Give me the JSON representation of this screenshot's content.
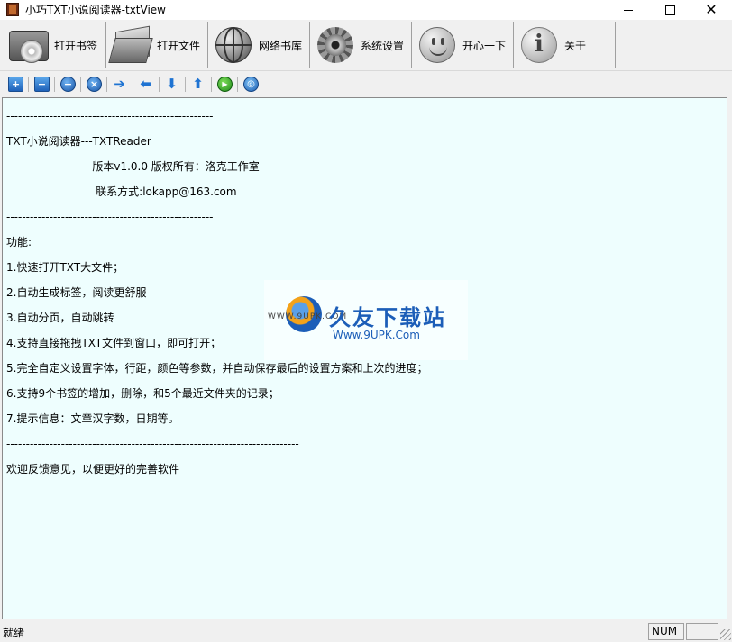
{
  "window": {
    "title": "小巧TXT小说阅读器-txtView",
    "controls": {
      "minimize": "—",
      "maximize": "□",
      "close": "✕"
    }
  },
  "main_toolbar": [
    {
      "id": "open-bookmark",
      "label": "打开书签",
      "icon": "bookmark-disc-icon"
    },
    {
      "id": "open-file",
      "label": "打开文件",
      "icon": "folder-icon"
    },
    {
      "id": "web-library",
      "label": "网络书库",
      "icon": "globe-icon"
    },
    {
      "id": "settings",
      "label": "系统设置",
      "icon": "gear-icon"
    },
    {
      "id": "fun",
      "label": "开心一下",
      "icon": "smiley-icon"
    },
    {
      "id": "about",
      "label": "关于",
      "icon": "info-icon"
    }
  ],
  "small_toolbar": [
    {
      "id": "add",
      "icon": "plus-square-icon",
      "glyph": "+"
    },
    {
      "id": "remove",
      "icon": "minus-square-icon",
      "glyph": "−"
    },
    {
      "id": "minus-circle",
      "icon": "minus-circle-icon",
      "glyph": "−"
    },
    {
      "id": "close-circle",
      "icon": "close-circle-icon",
      "glyph": "×"
    },
    {
      "id": "arrow-right",
      "icon": "arrow-right-icon",
      "glyph": "➔"
    },
    {
      "id": "arrow-left",
      "icon": "arrow-left-icon",
      "glyph": "⬅"
    },
    {
      "id": "arrow-down",
      "icon": "arrow-down-icon",
      "glyph": "⬇"
    },
    {
      "id": "arrow-up",
      "icon": "arrow-up-icon",
      "glyph": "⬆"
    },
    {
      "id": "play",
      "icon": "play-icon",
      "glyph": "▶"
    },
    {
      "id": "web",
      "icon": "globe-small-icon",
      "glyph": "◎"
    }
  ],
  "content": {
    "lines": [
      "-----------------------------------------------------",
      "TXT小说阅读器---TXTReader",
      "                         版本v1.0.0 版权所有：洛克工作室",
      "                          联系方式:lokapp@163.com",
      "-----------------------------------------------------",
      "功能:",
      "1.快速打开TXT大文件；",
      "2.自动生成标签，阅读更舒服",
      "3.自动分页，自动跳转",
      "4.支持直接拖拽TXT文件到窗口，即可打开；",
      "5.完全自定义设置字体，行距，颜色等参数，并自动保存最后的设置方案和上次的进度；",
      "6.支持9个书签的增加，删除，和5个最近文件夹的记录；",
      "7.提示信息：文章汉字数，日期等。",
      "---------------------------------------------------------------------------",
      "欢迎反馈意见，以便更好的完善软件"
    ]
  },
  "watermark": {
    "url_small": "WWW.9UPK.COM",
    "name": "久友下载站",
    "url": "Www.9UPK.Com"
  },
  "status_bar": {
    "text": "就绪",
    "num": "NUM",
    "extra": ""
  },
  "colors": {
    "content_bg": "#eefefe",
    "accent": "#1c5eb8"
  }
}
